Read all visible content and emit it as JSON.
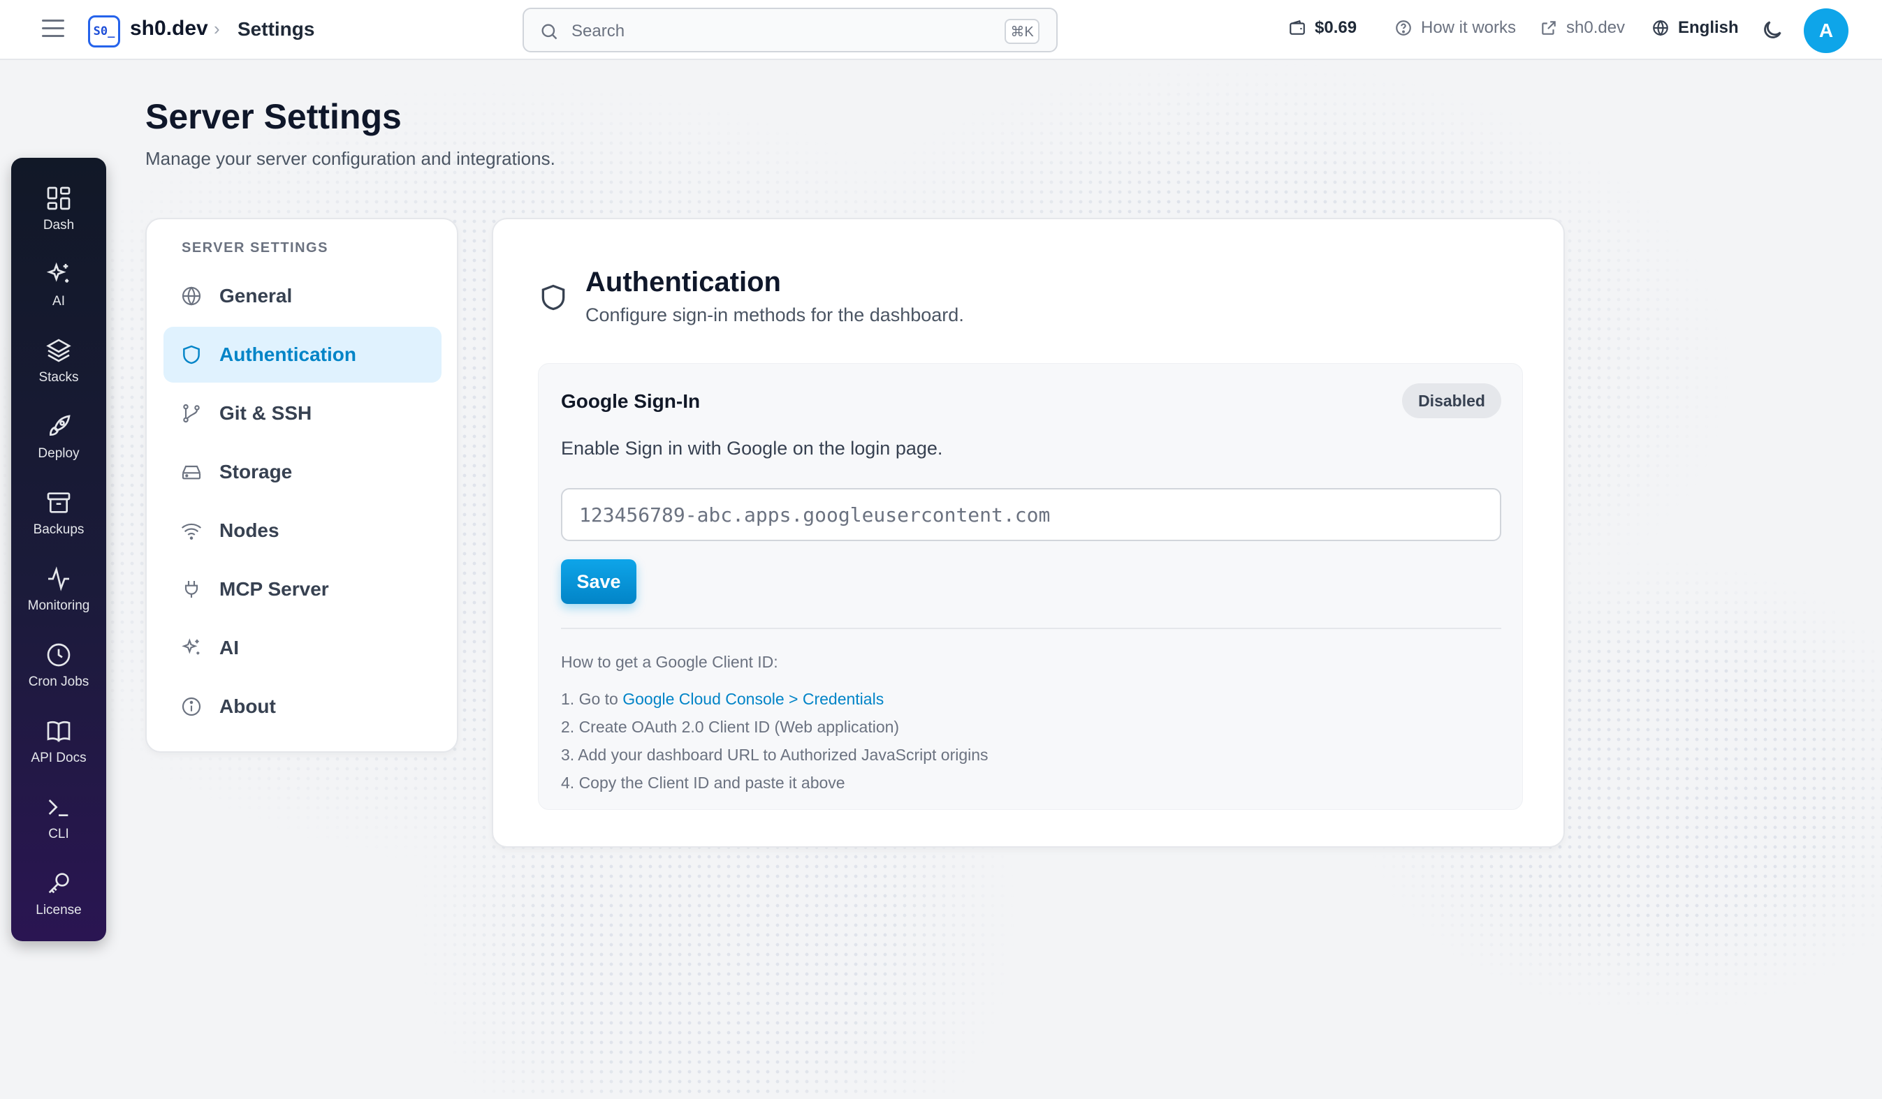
{
  "header": {
    "logo_text": "S0_",
    "brand": "sh0.dev",
    "breadcrumb_separator": "›",
    "breadcrumb_page": "Settings",
    "search_placeholder": "Search",
    "search_shortcut": "⌘K",
    "balance": "$0.69",
    "how_it_works": "How it works",
    "site_link": "sh0.dev",
    "language": "English",
    "avatar_initial": "A"
  },
  "dock": {
    "items": [
      {
        "label": "Dash",
        "icon": "grid-icon"
      },
      {
        "label": "AI",
        "icon": "sparkles-icon"
      },
      {
        "label": "Stacks",
        "icon": "layers-icon"
      },
      {
        "label": "Deploy",
        "icon": "rocket-icon"
      },
      {
        "label": "Backups",
        "icon": "archive-icon"
      },
      {
        "label": "Monitoring",
        "icon": "activity-icon"
      },
      {
        "label": "Cron Jobs",
        "icon": "clock-icon"
      },
      {
        "label": "API Docs",
        "icon": "book-icon"
      },
      {
        "label": "CLI",
        "icon": "terminal-icon"
      },
      {
        "label": "License",
        "icon": "key-icon"
      }
    ]
  },
  "page": {
    "title": "Server Settings",
    "subtitle": "Manage your server configuration and integrations."
  },
  "settings_nav": {
    "heading": "SERVER SETTINGS",
    "items": [
      {
        "label": "General",
        "icon": "globe-icon"
      },
      {
        "label": "Authentication",
        "icon": "shield-icon",
        "active": true
      },
      {
        "label": "Git & SSH",
        "icon": "git-branch-icon"
      },
      {
        "label": "Storage",
        "icon": "hard-drive-icon"
      },
      {
        "label": "Nodes",
        "icon": "wifi-icon"
      },
      {
        "label": "MCP Server",
        "icon": "plug-icon"
      },
      {
        "label": "AI",
        "icon": "sparkles-icon"
      },
      {
        "label": "About",
        "icon": "info-icon"
      }
    ]
  },
  "auth": {
    "title": "Authentication",
    "subtitle": "Configure sign-in methods for the dashboard.",
    "google": {
      "title": "Google Sign-In",
      "status": "Disabled",
      "description": "Enable Sign in with Google on the login page.",
      "client_id_value": "",
      "client_id_placeholder": "123456789-abc.apps.googleusercontent.com",
      "save_label": "Save",
      "help_title": "How to get a Google Client ID:",
      "step1_prefix": "1. Go to ",
      "step1_link": "Google Cloud Console > Credentials",
      "step2": "2. Create OAuth 2.0 Client ID (Web application)",
      "step3": "3. Add your dashboard URL to Authorized JavaScript origins",
      "step4": "4. Copy the Client ID and paste it above"
    }
  },
  "colors": {
    "accent": "#0ea5e9",
    "accent_dark": "#0284c7",
    "active_nav_bg": "#e0f2fe",
    "dock_top": "#111827",
    "dock_bottom": "#2a1552"
  }
}
